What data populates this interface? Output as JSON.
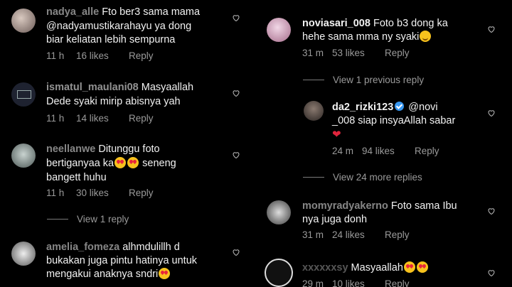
{
  "left": {
    "comments": [
      {
        "username": "nadya_alle",
        "text_lines": [
          "Fto ber3 sama mama",
          "@nadyamustikarahayu  ya dong",
          "biar keliatan lebih sempurna"
        ],
        "time": "11 h",
        "likes": "16 likes",
        "reply": "Reply"
      },
      {
        "username": "ismatul_maulani08",
        "text_lines": [
          "Masyaallah",
          "Dede syaki mirip abisnya yah"
        ],
        "time": "11 h",
        "likes": "14 likes",
        "reply": "Reply"
      },
      {
        "username": "neellanwe",
        "text_lines": [
          "Ditunggu foto",
          "bertiganyaa ka",
          "seneng",
          "bangett huhu"
        ],
        "time": "11 h",
        "likes": "30 likes",
        "reply": "Reply"
      },
      {
        "username": "amelia_fomeza",
        "text_lines": [
          "alhmdulillh d",
          "bukakan juga pintu hatinya untuk",
          "mengakui anaknya sndri"
        ]
      }
    ],
    "view_reply": "View 1 reply"
  },
  "right": {
    "comments": [
      {
        "username": "noviasari_008",
        "text_lines": [
          "Foto b3 dong ka",
          "hehe sama mma ny syaki"
        ],
        "time": "31 m",
        "likes": "53 likes",
        "reply": "Reply"
      },
      {
        "username": "momyradyakerno",
        "text_lines": [
          "Foto sama Ibu",
          "nya juga donh"
        ],
        "time": "31 m",
        "likes": "24 likes",
        "reply": "Reply"
      },
      {
        "username": "xxxxxxsy",
        "text_lines": [
          "Masyaallah"
        ],
        "time": "29 m",
        "likes": "10 likes",
        "reply": "Reply"
      }
    ],
    "view_previous": "View 1 previous reply",
    "view_more": "View 24 more replies",
    "nested": {
      "username": "da2_rizki123",
      "mention": "@novi",
      "text_lines": [
        "_008 siap insyaAllah sabar"
      ],
      "time": "24 m",
      "likes": "94 likes",
      "reply": "Reply"
    }
  },
  "icons": {
    "like": "heart-outline-icon",
    "verified": "verified-badge-icon"
  }
}
